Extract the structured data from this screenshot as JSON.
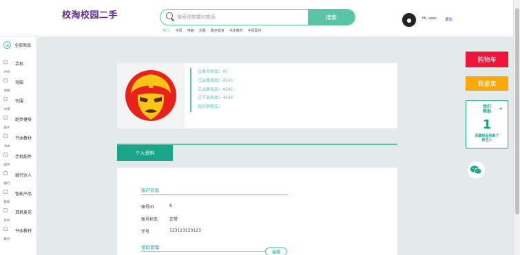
{
  "header": {
    "logo": "校淘校园二手",
    "search_placeholder": "搜索你想要的商品",
    "search_button": "搜索",
    "hot_links": [
      "热门:",
      "手机",
      "电脑",
      "衣服",
      "跑步健身",
      "书本教材",
      "手机配件"
    ],
    "greeting": "Hi, qwe",
    "logout": "退出"
  },
  "sidebar": {
    "all_goods": "全部商品",
    "categories": [
      {
        "label": "手机",
        "sub": "手机"
      },
      {
        "label": "电脑",
        "sub": "电脑"
      },
      {
        "label": "衣服",
        "sub": "衣服"
      },
      {
        "label": "跑步健身",
        "sub": "跑步"
      },
      {
        "label": "书本教材",
        "sub": "书本"
      },
      {
        "label": "手机配件",
        "sub": "配件"
      },
      {
        "label": "婚行达人",
        "sub": "婚行"
      },
      {
        "label": "智能产品",
        "sub": "智能"
      },
      {
        "label": "耳机麦克",
        "sub": "耳机"
      },
      {
        "label": "书本教材",
        "sub": "教材"
      }
    ]
  },
  "profile": {
    "stats": [
      "已发布商品：45",
      "已出售商品：4545",
      "正出售商品：4545",
      "已下架商品：4545",
      "我的购物车："
    ]
  },
  "tabs": {
    "active": "个人资料"
  },
  "account": {
    "section_title": "账户信息",
    "rows": [
      {
        "label": "账号ID",
        "value": "6"
      },
      {
        "label": "账号状态",
        "value": "正常"
      },
      {
        "label": "学号",
        "value": "123123123123"
      }
    ],
    "password_title": "密码管理",
    "edit_button": "编辑"
  },
  "right_panel": {
    "cart_button": "购物车",
    "sell_button": "我要卖",
    "help_title": "我们\n帮助",
    "help_number": "1",
    "help_text": "闲置物品找到了\n新主人"
  },
  "colors": {
    "accent": "#18a58a",
    "accent_light": "#5cc4a6",
    "logo": "#5b2a8e",
    "cart": "#f0153d",
    "sell": "#f7a909",
    "main_bg": "#e3eaea"
  }
}
